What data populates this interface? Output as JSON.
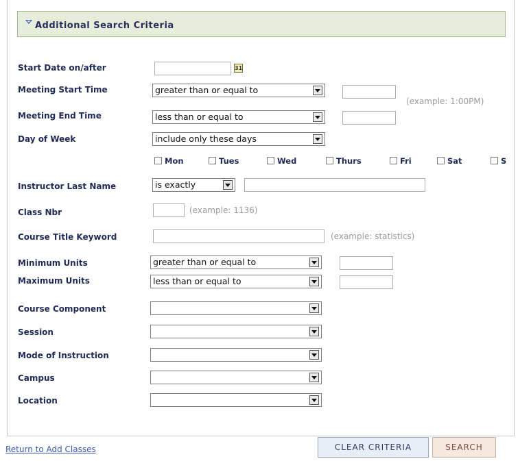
{
  "header": {
    "title": "Additional Search Criteria"
  },
  "fields": {
    "start_date": {
      "label": "Start Date on/after",
      "value": ""
    },
    "meeting_start": {
      "label": "Meeting Start Time",
      "operator": "greater than or equal to",
      "value": "",
      "example": "(example: 1:00PM)"
    },
    "meeting_end": {
      "label": "Meeting End Time",
      "operator": "less than or equal to",
      "value": ""
    },
    "day_of_week": {
      "label": "Day of Week",
      "operator": "include only these days",
      "days": [
        "Mon",
        "Tues",
        "Wed",
        "Thurs",
        "Fri",
        "Sat",
        "S"
      ]
    },
    "instructor": {
      "label": "Instructor Last Name",
      "operator": "is exactly",
      "value": ""
    },
    "class_nbr": {
      "label": "Class Nbr",
      "value": "",
      "example": "(example: 1136)"
    },
    "course_title": {
      "label": "Course Title Keyword",
      "value": "",
      "example": "(example: statistics)"
    },
    "min_units": {
      "label": "Minimum Units",
      "operator": "greater than or equal to",
      "value": ""
    },
    "max_units": {
      "label": "Maximum Units",
      "operator": "less than or equal to",
      "value": ""
    },
    "course_component": {
      "label": "Course Component",
      "value": ""
    },
    "session": {
      "label": "Session",
      "value": ""
    },
    "mode": {
      "label": "Mode of Instruction",
      "value": ""
    },
    "campus": {
      "label": "Campus",
      "value": ""
    },
    "location": {
      "label": "Location",
      "value": ""
    }
  },
  "footer": {
    "return_link": "Return to Add Classes",
    "clear_label": "CLEAR CRITERIA",
    "search_label": "SEARCH"
  },
  "colors": {
    "header_bg": "#e6eedb",
    "label_color": "#1f2a55",
    "link_color": "#3b5aa8"
  }
}
